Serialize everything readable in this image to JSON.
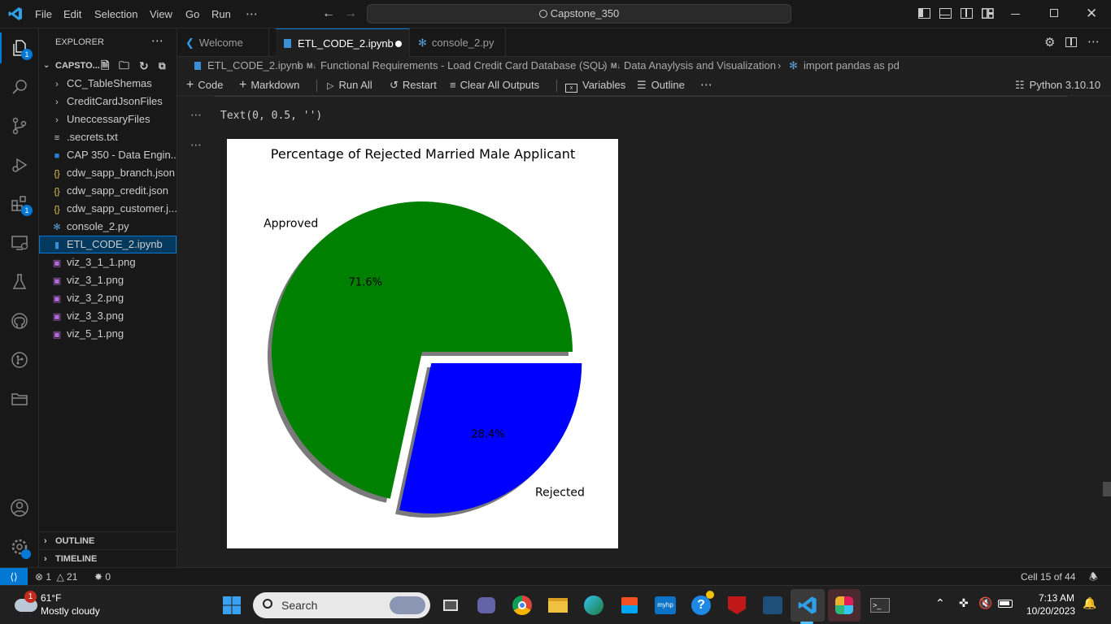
{
  "titlebar": {
    "menus": [
      "File",
      "Edit",
      "Selection",
      "View",
      "Go",
      "Run",
      "⋯"
    ],
    "search": "Capstone_350"
  },
  "activity": {
    "explorer_badge": "1",
    "extensions_badge": "1"
  },
  "sidebar": {
    "header": "EXPLORER",
    "folder": "CAPSTO...",
    "items": [
      {
        "label": "CC_TableShemas",
        "kind": "folder"
      },
      {
        "label": "CreditCardJsonFiles",
        "kind": "folder"
      },
      {
        "label": "UneccessaryFiles",
        "kind": "folder"
      },
      {
        "label": ".secrets.txt",
        "kind": "text"
      },
      {
        "label": "CAP 350 - Data Engin...",
        "kind": "doc"
      },
      {
        "label": "cdw_sapp_branch.json",
        "kind": "json"
      },
      {
        "label": "cdw_sapp_credit.json",
        "kind": "json"
      },
      {
        "label": "cdw_sapp_customer.j...",
        "kind": "json"
      },
      {
        "label": "console_2.py",
        "kind": "python"
      },
      {
        "label": "ETL_CODE_2.ipynb",
        "kind": "notebook"
      },
      {
        "label": "viz_3_1_1.png",
        "kind": "image"
      },
      {
        "label": "viz_3_1.png",
        "kind": "image"
      },
      {
        "label": "viz_3_2.png",
        "kind": "image"
      },
      {
        "label": "viz_3_3.png",
        "kind": "image"
      },
      {
        "label": "viz_5_1.png",
        "kind": "image"
      }
    ],
    "outline": "OUTLINE",
    "timeline": "TIMELINE"
  },
  "tabs": [
    {
      "label": "Welcome"
    },
    {
      "label": "ETL_CODE_2.ipynb"
    },
    {
      "label": "console_2.py"
    }
  ],
  "breadcrumbs": {
    "file": "ETL_CODE_2.ipynb",
    "section1": "Functional Requirements - Load Credit Card Database (SQL)",
    "section2": "Data Anaylysis and Visualization",
    "symbol": "import pandas as pd"
  },
  "toolbar": {
    "code": "Code",
    "markdown": "Markdown",
    "run_all": "Run All",
    "restart": "Restart",
    "clear": "Clear All Outputs",
    "variables": "Variables",
    "outline": "Outline",
    "more": "⋯",
    "kernel": "Python 3.10.10"
  },
  "output": {
    "text": "Text(0, 0.5, '')",
    "ellipsis": "⋯"
  },
  "chart_data": {
    "type": "pie",
    "title": "Percentage of Rejected Married Male Applicant",
    "categories": [
      "Approved",
      "Rejected"
    ],
    "values": [
      71.6,
      28.4
    ],
    "pct_labels": [
      "71.6%",
      "28.4%"
    ],
    "colors": [
      "#008000",
      "#0000ff"
    ],
    "explode": [
      0,
      0.1
    ],
    "shadow": true
  },
  "statusbar": {
    "errors": "1",
    "warnings": "21",
    "ports": "0",
    "cell": "Cell 15 of 44"
  },
  "taskbar": {
    "weather_temp": "61°F",
    "weather_desc": "Mostly cloudy",
    "weather_badge": "1",
    "search": "Search",
    "time": "7:13 AM",
    "date": "10/20/2023"
  }
}
